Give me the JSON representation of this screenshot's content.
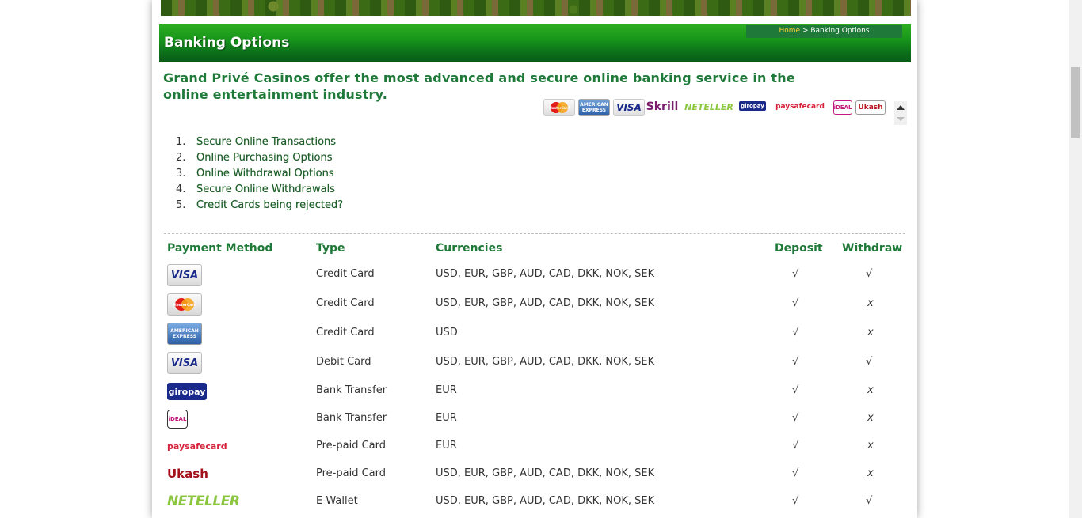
{
  "header": {
    "title": "Banking Options",
    "breadcrumb": {
      "home": "Home",
      "separator": " > ",
      "current": "Banking Options"
    }
  },
  "intro": "Grand Privé Casinos offer the most advanced and secure online banking service in the online entertainment industry.",
  "strip_logos": [
    {
      "icon": "mastercard-logo-icon",
      "label": "MasterCard"
    },
    {
      "icon": "amex-logo-icon",
      "label": "AMERICAN EXPRESS"
    },
    {
      "icon": "visa-logo-icon",
      "label": "VISA"
    },
    {
      "icon": "skrill-logo-icon",
      "label": "Skrill"
    },
    {
      "icon": "neteller-logo-icon",
      "label": "NETELLER"
    },
    {
      "icon": "giropay-logo-icon",
      "label": "giropay"
    },
    {
      "icon": "paysafecard-logo-icon",
      "label": "paysafecard"
    },
    {
      "icon": "ideal-logo-icon",
      "label": "iDEAL"
    },
    {
      "icon": "ukash-logo-icon",
      "label": "Ukash"
    }
  ],
  "toc": [
    {
      "num": "1.",
      "label": "Secure Online Transactions"
    },
    {
      "num": "2.",
      "label": "Online Purchasing Options"
    },
    {
      "num": "3.",
      "label": "Online Withdrawal Options"
    },
    {
      "num": "4.",
      "label": "Secure Online Withdrawals"
    },
    {
      "num": "5.",
      "label": "Credit Cards being rejected?"
    }
  ],
  "table": {
    "headers": [
      "Payment Method",
      "Type",
      "Currencies",
      "Deposit",
      "Withdraw"
    ],
    "rows": [
      {
        "logo": "VISA",
        "icon": "visa-logo-icon",
        "type": "Credit Card",
        "currencies": "USD, EUR, GBP, AUD, CAD, DKK, NOK, SEK",
        "deposit": "√",
        "withdraw": "√"
      },
      {
        "logo": "MasterCard",
        "icon": "mastercard-logo-icon",
        "type": "Credit Card",
        "currencies": "USD, EUR, GBP, AUD, CAD, DKK, NOK, SEK",
        "deposit": "√",
        "withdraw": "x"
      },
      {
        "logo": "AMERICAN EXPRESS",
        "icon": "amex-logo-icon",
        "type": "Credit Card",
        "currencies": "USD",
        "deposit": "√",
        "withdraw": "x"
      },
      {
        "logo": "VISA",
        "icon": "visa-logo-icon",
        "type": "Debit Card",
        "currencies": "USD, EUR, GBP, AUD, CAD, DKK, NOK, SEK",
        "deposit": "√",
        "withdraw": "√"
      },
      {
        "logo": "giropay",
        "icon": "giropay-logo-icon",
        "type": "Bank Transfer",
        "currencies": "EUR",
        "deposit": "√",
        "withdraw": "x"
      },
      {
        "logo": "iDEAL",
        "icon": "ideal-logo-icon",
        "type": "Bank Transfer",
        "currencies": "EUR",
        "deposit": "√",
        "withdraw": "x"
      },
      {
        "logo": "paysafecard",
        "icon": "paysafecard-logo-icon",
        "type": "Pre-paid Card",
        "currencies": "EUR",
        "deposit": "√",
        "withdraw": "x"
      },
      {
        "logo": "Ukash",
        "icon": "ukash-logo-icon",
        "type": "Pre-paid Card",
        "currencies": "USD, EUR, GBP, AUD, CAD, DKK, NOK, SEK",
        "deposit": "√",
        "withdraw": "x"
      },
      {
        "logo": "NETELLER",
        "icon": "neteller-logo-icon",
        "type": "E-Wallet",
        "currencies": "USD, EUR, GBP, AUD, CAD, DKK, NOK, SEK",
        "deposit": "√",
        "withdraw": "√"
      }
    ]
  },
  "colors": {
    "accent_green": "#1f7a3a",
    "bar_green": "#18961a",
    "breadcrumb_home": "#ffcc33"
  }
}
